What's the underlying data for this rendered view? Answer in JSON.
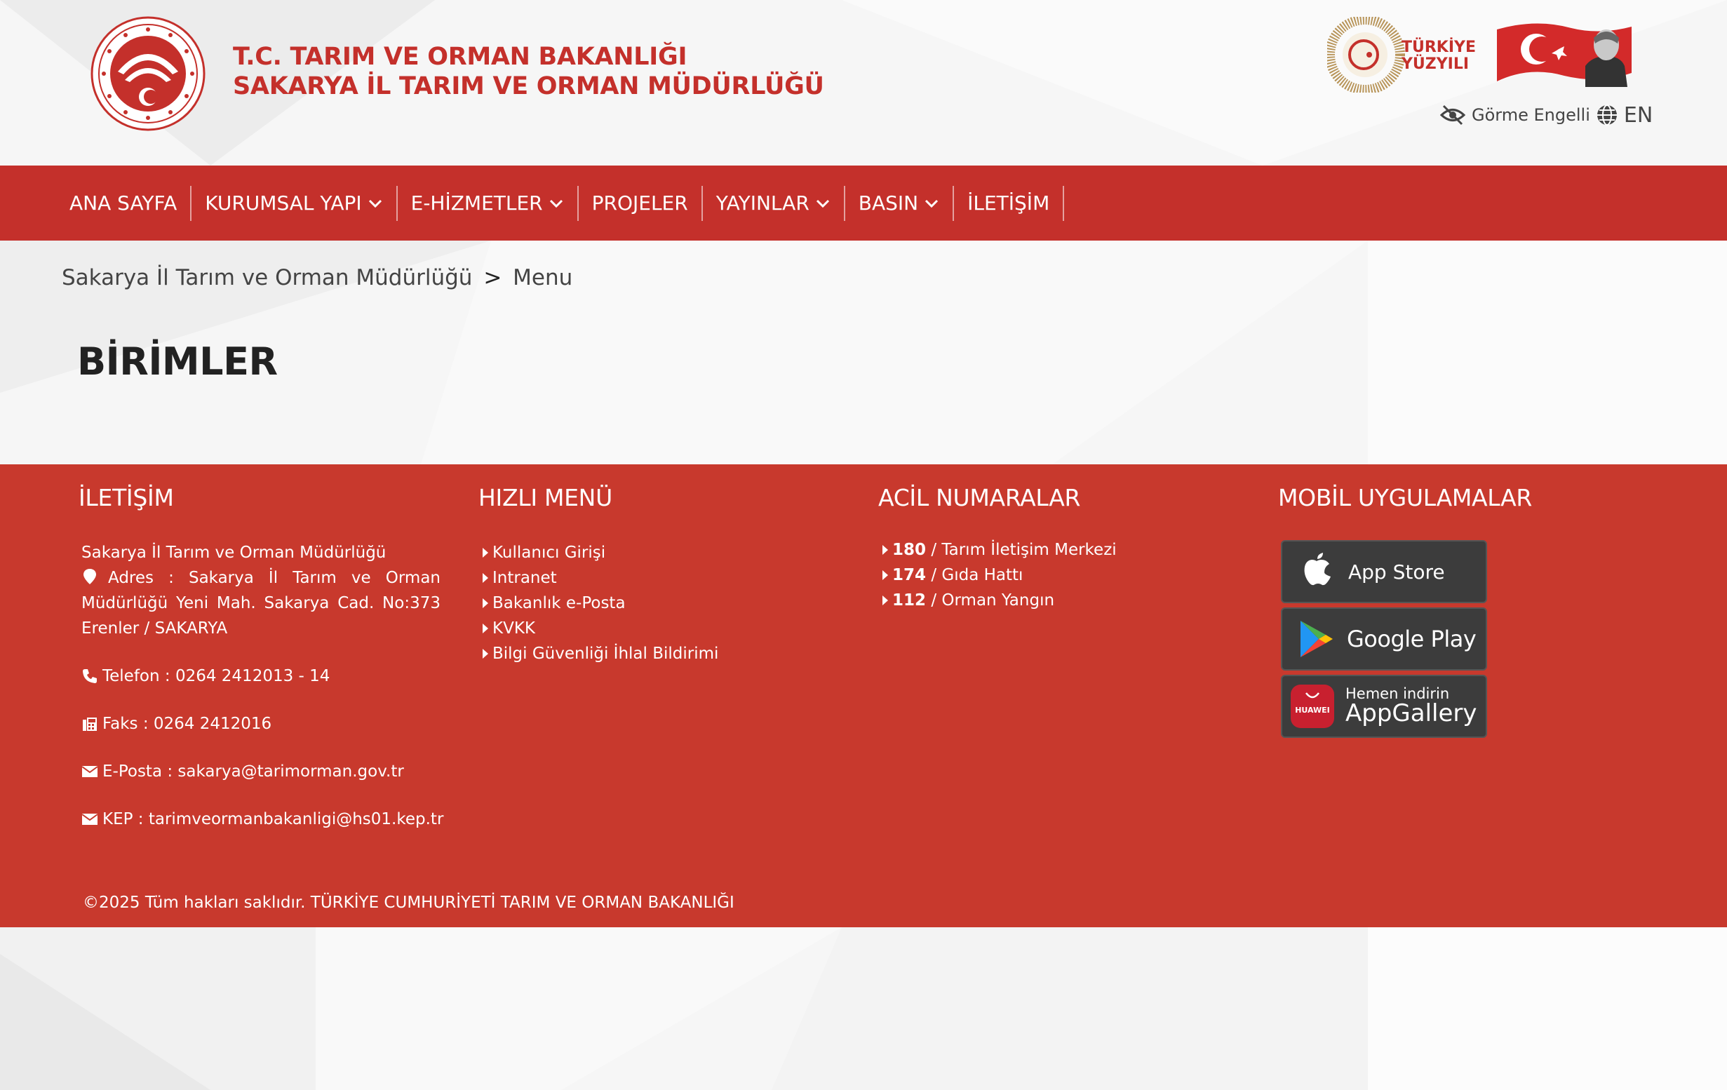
{
  "header": {
    "title_line1": "T.C. TARIM VE ORMAN BAKANLIĞI",
    "title_line2": "SAKARYA İL TARIM VE ORMAN MÜDÜRLÜĞÜ",
    "turkiye_yuzyili_line1": "TÜRKİYE",
    "turkiye_yuzyili_line2": "YÜZYILI",
    "accessibility_label": "Görme Engelli",
    "language_label": "EN"
  },
  "nav": {
    "items": [
      {
        "label": "ANA SAYFA",
        "dropdown": false
      },
      {
        "label": "KURUMSAL YAPI",
        "dropdown": true
      },
      {
        "label": "E-HİZMETLER",
        "dropdown": true
      },
      {
        "label": "PROJELER",
        "dropdown": false
      },
      {
        "label": "YAYINLAR",
        "dropdown": true
      },
      {
        "label": "BASIN",
        "dropdown": true
      },
      {
        "label": "İLETİŞİM",
        "dropdown": false
      }
    ]
  },
  "breadcrumb": {
    "parent": "Sakarya İl Tarım ve Orman Müdürlüğü",
    "separator": ">",
    "current": "Menu"
  },
  "main": {
    "title": "BİRİMLER"
  },
  "footer": {
    "contact": {
      "heading": "İLETİŞİM",
      "org": "Sakarya İl Tarım ve Orman Müdürlüğü",
      "address": "Adres : Sakarya İl Tarım ve Orman Müdürlüğü Yeni Mah. Sakarya Cad. No:373 Erenler / SAKARYA",
      "phone": "Telefon : 0264 2412013 - 14",
      "fax": "Faks : 0264 2412016",
      "email": "E-Posta : sakarya@tarimorman.gov.tr",
      "kep": "KEP : tarimveormanbakanligi@hs01.kep.tr"
    },
    "quick_menu": {
      "heading": "HIZLI MENÜ",
      "items": [
        "Kullanıcı Girişi",
        "Intranet",
        "Bakanlık e-Posta",
        "KVKK",
        "Bilgi Güvenliği İhlal Bildirimi"
      ]
    },
    "emergency": {
      "heading": "ACİL NUMARALAR",
      "items": [
        {
          "number": "180",
          "label": " / Tarım İletişim Merkezi"
        },
        {
          "number": "174",
          "label": " / Gıda Hattı"
        },
        {
          "number": "112",
          "label": " / Orman Yangın"
        }
      ]
    },
    "mobile": {
      "heading": "MOBİL UYGULAMALAR",
      "app_store": "App Store",
      "google_play": "Google Play",
      "huawei_sub": "Hemen indirin",
      "huawei_main": "AppGallery",
      "huawei_brand": "HUAWEI"
    },
    "copyright": "©2025 Tüm hakları saklıdır. TÜRKİYE CUMHURİYETİ TARIM VE ORMAN BAKANLIĞI"
  },
  "colors": {
    "brand_red": "#c4302b",
    "footer_red": "#c8392d",
    "store_button": "#3c3c3c"
  }
}
